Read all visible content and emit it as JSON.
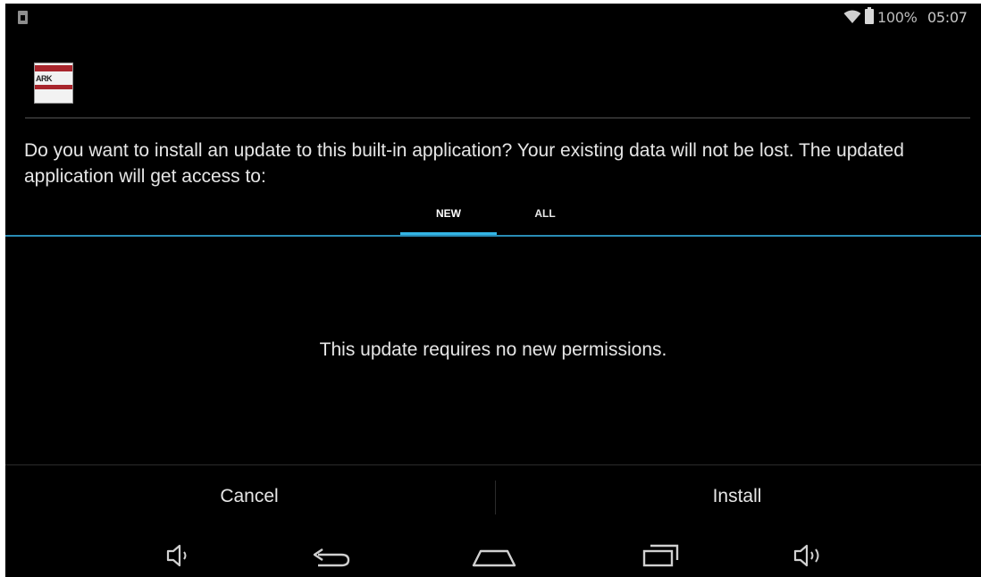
{
  "status_bar": {
    "battery_percent": "100%",
    "time": "05:07",
    "icons": [
      "notification-icon",
      "wifi-icon",
      "battery-icon"
    ]
  },
  "app": {
    "icon_name": "app-logo-icon",
    "icon_text": "ARK"
  },
  "dialog": {
    "message": "Do you want to install an update to this built-in application? Your existing data will not be lost. The updated application will get access to:",
    "tabs": [
      {
        "label": "NEW",
        "selected": true
      },
      {
        "label": "ALL",
        "selected": false
      }
    ],
    "content_text": "This update requires no new permissions.",
    "cancel_label": "Cancel",
    "install_label": "Install"
  },
  "nav_bar": {
    "icons": [
      "volume-down-icon",
      "back-icon",
      "home-icon",
      "recents-icon",
      "volume-up-icon"
    ]
  },
  "colors": {
    "background": "#000000",
    "accent": "#33b5e5",
    "text": "#e6e6e6"
  }
}
